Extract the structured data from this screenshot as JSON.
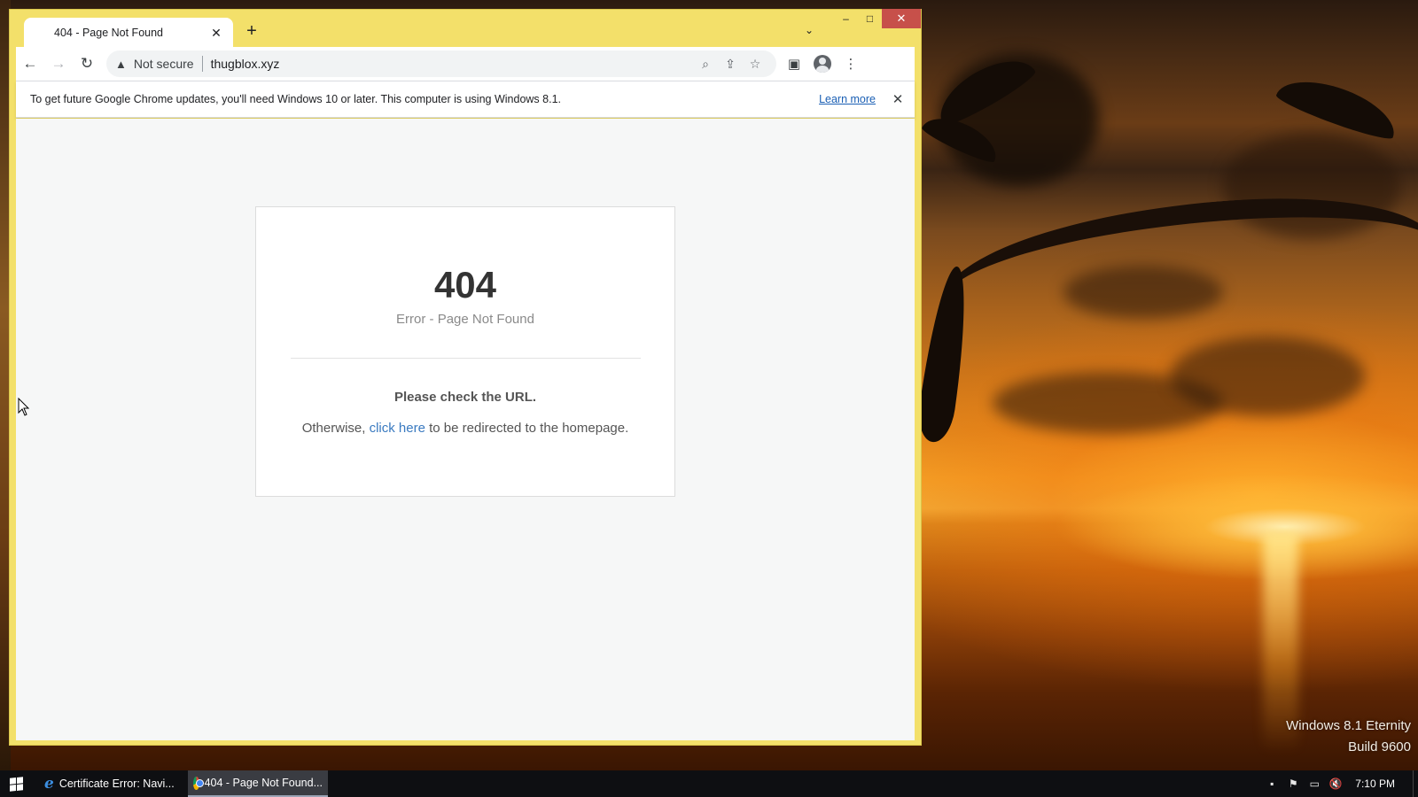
{
  "browser": {
    "tab": {
      "title": "404 - Page Not Found",
      "favicon_icon": "none"
    },
    "new_tab_label": "+",
    "window_controls": {
      "minimize": "–",
      "maximize": "□",
      "close": "✕"
    },
    "address_bar": {
      "security_icon": "warning-icon",
      "security_label": "Not secure",
      "url": "thugblox.xyz"
    },
    "infobar": {
      "message": "To get future Google Chrome updates, you'll need Windows 10 or later. This computer is using Windows 8.1.",
      "link_label": "Learn more"
    }
  },
  "page": {
    "error_code": "404",
    "error_subtitle": "Error - Page Not Found",
    "check_message": "Please check the URL.",
    "redirect_prefix": "Otherwise, ",
    "redirect_link": "click here",
    "redirect_suffix": " to be redirected to the homepage."
  },
  "desktop": {
    "watermark_line1": "Windows 8.1 Eternity",
    "watermark_line2": "Build 9600"
  },
  "taskbar": {
    "items": [
      {
        "label": "Certificate Error: Navi...",
        "icon": "internet-explorer-icon",
        "active": false
      },
      {
        "label": "404 - Page Not Found...",
        "icon": "chrome-icon",
        "active": true
      }
    ],
    "clock": "7:10 PM"
  },
  "colors": {
    "window_frame": "#f3e06a",
    "close_button": "#c7504a",
    "link": "#3a7ac0",
    "infobar_link": "#1a5fb4"
  }
}
